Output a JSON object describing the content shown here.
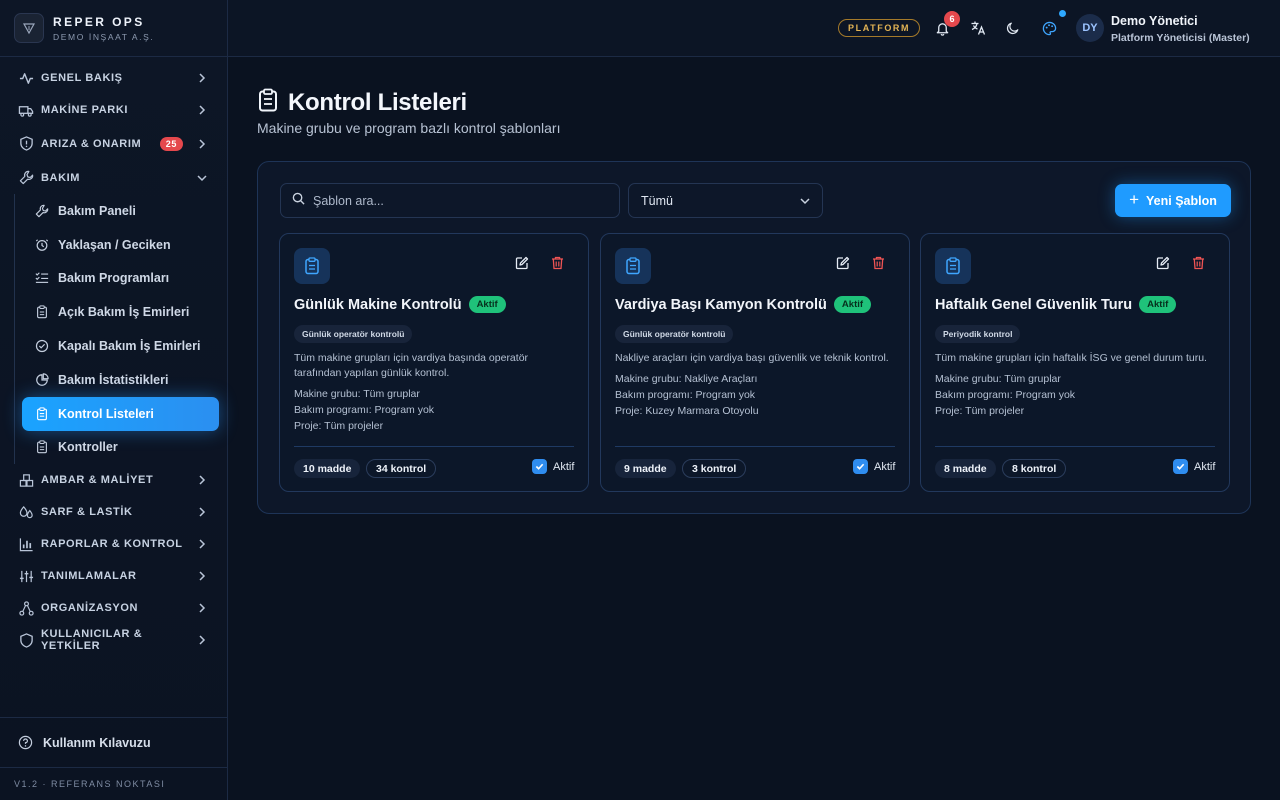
{
  "brand": {
    "title": "REPER OPS",
    "subtitle": "DEMO İNŞAAT A.Ş."
  },
  "topbar": {
    "platform": "PLATFORM",
    "notifications_count": "6",
    "avatar_initials": "DY",
    "user_name": "Demo Yönetici",
    "user_role": "Platform Yöneticisi (Master)"
  },
  "sidebar": {
    "items": [
      {
        "label": "GENEL BAKIŞ",
        "icon": "activity-icon"
      },
      {
        "label": "MAKİNE PARKI",
        "icon": "truck-icon"
      },
      {
        "label": "ARIZA & ONARIM",
        "icon": "shield-alert-icon",
        "badge": "25"
      },
      {
        "label": "BAKIM",
        "icon": "wrench-icon",
        "expanded": true
      }
    ],
    "bakim_sub": [
      {
        "label": "Bakım Paneli",
        "icon": "wrench-icon"
      },
      {
        "label": "Yaklaşan / Geciken",
        "icon": "clock-alert-icon"
      },
      {
        "label": "Bakım Programları",
        "icon": "list-checks-icon"
      },
      {
        "label": "Açık Bakım İş Emirleri",
        "icon": "clipboard-icon"
      },
      {
        "label": "Kapalı Bakım İş Emirleri",
        "icon": "check-circle-icon"
      },
      {
        "label": "Bakım İstatistikleri",
        "icon": "pie-chart-icon"
      },
      {
        "label": "Kontrol Listeleri",
        "icon": "clipboard-list-icon",
        "active": true
      },
      {
        "label": "Kontroller",
        "icon": "clipboard-icon"
      }
    ],
    "items_after": [
      {
        "label": "AMBAR & MALİYET",
        "icon": "boxes-icon"
      },
      {
        "label": "SARF & LASTİK",
        "icon": "droplets-icon"
      },
      {
        "label": "RAPORLAR & KONTROL",
        "icon": "bar-chart-icon"
      },
      {
        "label": "TANIMLAMALAR",
        "icon": "sliders-icon"
      },
      {
        "label": "ORGANİZASYON",
        "icon": "network-icon"
      },
      {
        "label": "KULLANICILAR & YETKİLER",
        "icon": "shield-icon"
      }
    ],
    "help": "Kullanım Kılavuzu",
    "version": "V1.2 · REFERANS NOKTASI"
  },
  "main": {
    "title": "Kontrol Listeleri",
    "subtitle": "Makine grubu ve program bazlı kontrol şablonları",
    "search_placeholder": "Şablon ara...",
    "filter_value": "Tümü",
    "new_button": "Yeni Şablon"
  },
  "cards": [
    {
      "title": "Günlük Makine Kontrolü",
      "status": "Aktif",
      "tag": "Günlük operatör kontrolü",
      "description": "Tüm makine grupları için vardiya başında operatör tarafından yapılan günlük kontrol.",
      "meta": [
        "Makine grubu: Tüm gruplar",
        "Bakım programı: Program yok",
        "Proje: Tüm projeler"
      ],
      "items": "10 madde",
      "controls": "34 kontrol",
      "active_label": "Aktif"
    },
    {
      "title": "Vardiya Başı Kamyon Kontrolü",
      "status": "Aktif",
      "tag": "Günlük operatör kontrolü",
      "description": "Nakliye araçları için vardiya başı güvenlik ve teknik kontrol.",
      "meta": [
        "Makine grubu: Nakliye Araçları",
        "Bakım programı: Program yok",
        "Proje: Kuzey Marmara Otoyolu"
      ],
      "items": "9 madde",
      "controls": "3 kontrol",
      "active_label": "Aktif"
    },
    {
      "title": "Haftalık Genel Güvenlik Turu",
      "status": "Aktif",
      "tag": "Periyodik kontrol",
      "description": "Tüm makine grupları için haftalık İSG ve genel durum turu.",
      "meta": [
        "Makine grubu: Tüm gruplar",
        "Bakım programı: Program yok",
        "Proje: Tüm projeler"
      ],
      "items": "8 madde",
      "controls": "8 kontrol",
      "active_label": "Aktif"
    }
  ],
  "colors": {
    "accent": "#1f9bff",
    "success": "#1fc27a",
    "danger": "#e5484d",
    "warning": "#e2b354"
  }
}
